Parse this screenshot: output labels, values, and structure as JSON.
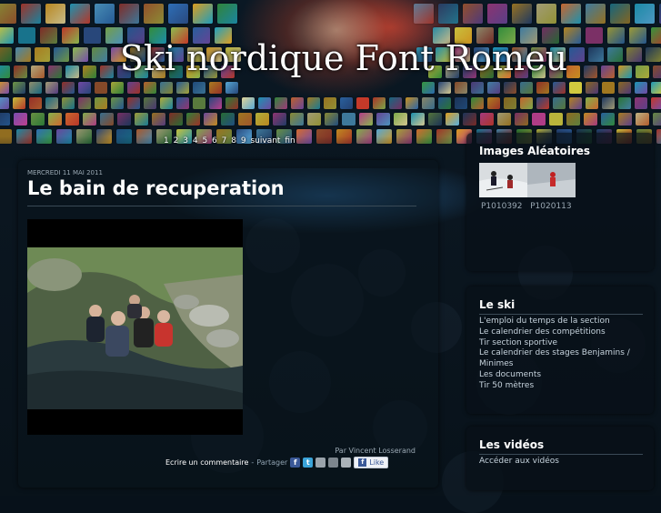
{
  "header": {
    "site_title": "Ski nordique Font Romeu",
    "pagination": [
      "1",
      "2",
      "3",
      "4",
      "5",
      "6",
      "7",
      "8",
      "9",
      "suivant",
      "fin"
    ]
  },
  "post": {
    "date": "MERCREDI 11 MAI 2011",
    "title": "Le bain de recuperation",
    "author": "Par Vincent Losserand",
    "comment_label": "Ecrire un commentaire",
    "separator": "-",
    "share_label": "Partager",
    "share_icons": [
      "facebook-icon",
      "twitter-icon",
      "email-icon",
      "print-icon",
      "bookmark-icon"
    ],
    "like_label": "Like"
  },
  "sidebar": {
    "random_images": {
      "title": "Images Aléatoires",
      "captions": [
        "P1010392",
        "P1020113"
      ]
    },
    "le_ski": {
      "title": "Le ski",
      "links": [
        "L'emploi du temps de la section",
        "Le calendrier des compétitions",
        "Tir section sportive",
        "Le calendrier des stages Benjamins /",
        "Minimes",
        "Les documents",
        "Tir 50 mètres"
      ]
    },
    "videos": {
      "title": "Les vidéos",
      "link": "Accéder aux vidéos"
    }
  },
  "colors": {
    "background": "#07111a",
    "title_text": "#ffffff",
    "link_text": "#c6d3dd",
    "like_blue": "#3b5998"
  }
}
